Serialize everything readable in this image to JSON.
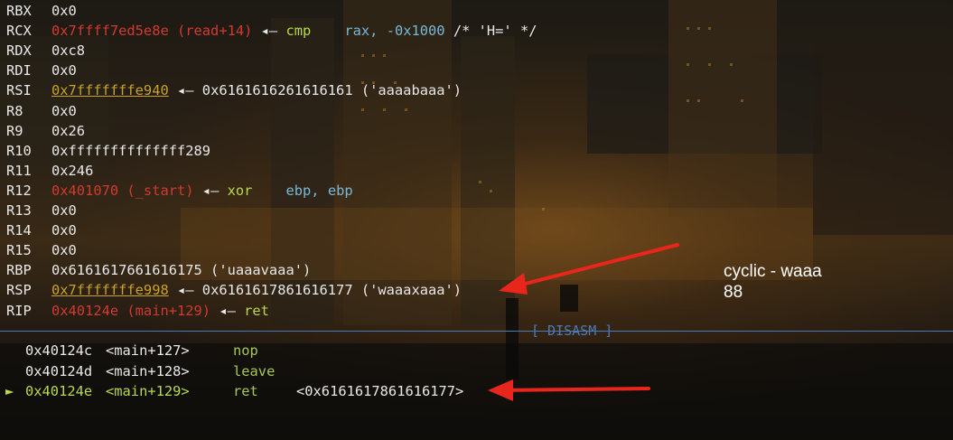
{
  "registers": [
    {
      "name": "RBX",
      "parts": [
        {
          "text": "0x0",
          "cls": "white"
        }
      ]
    },
    {
      "name": "RCX",
      "parts": [
        {
          "text": "0x7ffff7ed5e8e (read+14)",
          "cls": "addr-red"
        },
        {
          "text": " ◂— ",
          "cls": "white"
        },
        {
          "text": "cmp",
          "cls": "green"
        },
        {
          "text": "    rax, ",
          "cls": "blue"
        },
        {
          "text": "-0x1000",
          "cls": "blue"
        },
        {
          "text": " /* 'H=' */",
          "cls": "white"
        }
      ]
    },
    {
      "name": "RDX",
      "parts": [
        {
          "text": "0xc8",
          "cls": "white"
        }
      ]
    },
    {
      "name": "RDI",
      "parts": [
        {
          "text": "0x0",
          "cls": "white"
        }
      ]
    },
    {
      "name": "RSI",
      "parts": [
        {
          "text": "0x7fffffffe940",
          "cls": "addr-yel"
        },
        {
          "text": " ◂— 0x6161616261616161 ('aaaabaaa')",
          "cls": "white"
        }
      ]
    },
    {
      "name": "R8",
      "parts": [
        {
          "text": "0x0",
          "cls": "white"
        }
      ]
    },
    {
      "name": "R9",
      "parts": [
        {
          "text": "0x26",
          "cls": "white"
        }
      ]
    },
    {
      "name": "R10",
      "parts": [
        {
          "text": "0xffffffffffffff289",
          "cls": "white"
        }
      ]
    },
    {
      "name": "R11",
      "parts": [
        {
          "text": "0x246",
          "cls": "white"
        }
      ]
    },
    {
      "name": "R12",
      "parts": [
        {
          "text": "0x401070 (_start)",
          "cls": "addr-red"
        },
        {
          "text": " ◂— ",
          "cls": "white"
        },
        {
          "text": "xor",
          "cls": "green"
        },
        {
          "text": "    ebp, ebp",
          "cls": "blue"
        }
      ]
    },
    {
      "name": "R13",
      "parts": [
        {
          "text": "0x0",
          "cls": "white"
        }
      ]
    },
    {
      "name": "R14",
      "parts": [
        {
          "text": "0x0",
          "cls": "white"
        }
      ]
    },
    {
      "name": "R15",
      "parts": [
        {
          "text": "0x0",
          "cls": "white"
        }
      ]
    },
    {
      "name": "RBP",
      "parts": [
        {
          "text": "0x6161617661616175 ('uaaavaaa')",
          "cls": "white"
        }
      ]
    },
    {
      "name": "RSP",
      "parts": [
        {
          "text": "0x7fffffffe998",
          "cls": "addr-yel"
        },
        {
          "text": " ◂— 0x6161617861616177 ('waaaxaaa')",
          "cls": "white"
        }
      ]
    },
    {
      "name": "RIP",
      "parts": [
        {
          "text": "0x40124e (main+129)",
          "cls": "addr-red"
        },
        {
          "text": " ◂— ",
          "cls": "white"
        },
        {
          "text": "ret",
          "cls": "green"
        }
      ]
    }
  ],
  "disasm_label": "[ DISASM ]",
  "disasm": [
    {
      "marker": "",
      "addr": "0x40124c",
      "sym": "<main+127>",
      "mnem": "nop",
      "operand": "",
      "current": false
    },
    {
      "marker": "",
      "addr": "0x40124d",
      "sym": "<main+128>",
      "mnem": "leave",
      "operand": "",
      "current": false
    },
    {
      "marker": "►",
      "addr": "0x40124e",
      "sym": "<main+129>",
      "mnem": "ret",
      "operand": "<0x6161617861616177>",
      "current": true
    }
  ],
  "annotation": {
    "line1": "cyclic - waaa",
    "line2": "88"
  },
  "colors": {
    "red": "#d23a30",
    "yellow": "#c9a227",
    "green": "#b9d84a",
    "blue": "#78b8d8",
    "divider": "#4a7ab8",
    "arrow": "#e8261c"
  }
}
